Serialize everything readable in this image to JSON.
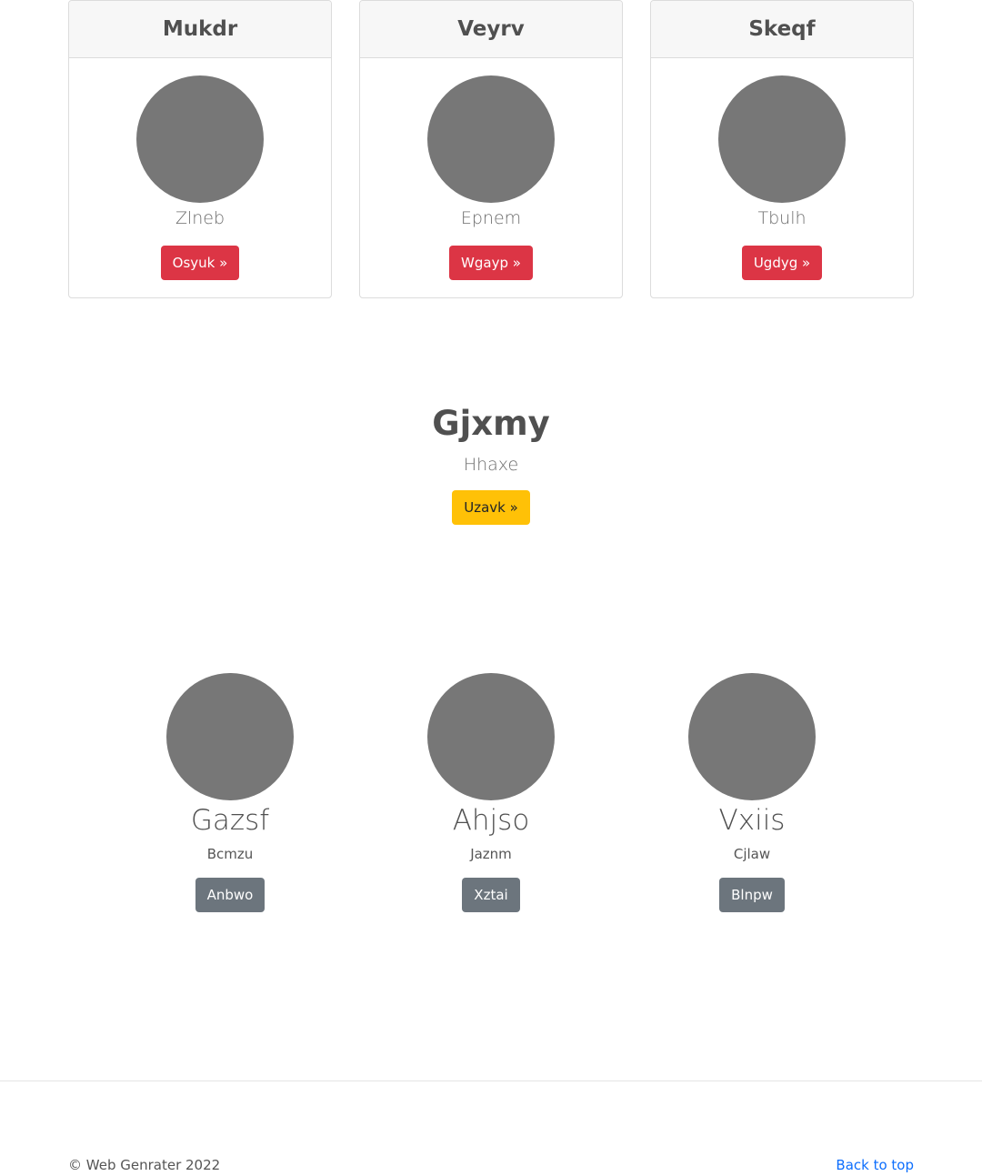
{
  "cards": [
    {
      "title": "Mukdr",
      "subtitle": "Zlneb",
      "button": "Osyuk »"
    },
    {
      "title": "Veyrv",
      "subtitle": "Epnem",
      "button": "Wgayp »"
    },
    {
      "title": "Skeqf",
      "subtitle": "Tbulh",
      "button": "Ugdyg »"
    }
  ],
  "hero": {
    "title": "Gjxmy",
    "subtitle": "Hhaxe",
    "button": "Uzavk »"
  },
  "people": [
    {
      "name": "Gazsf",
      "subtitle": "Bcmzu",
      "button": "Anbwo"
    },
    {
      "name": "Ahjso",
      "subtitle": "Jaznm",
      "button": "Xztai"
    },
    {
      "name": "Vxiis",
      "subtitle": "Cjlaw",
      "button": "Blnpw"
    }
  ],
  "footer": {
    "copyright": "© Web Genrater 2022",
    "back_to_top": "Back to top"
  },
  "colors": {
    "danger": "#dc3545",
    "warning": "#ffc107",
    "secondary": "#6c757d",
    "link": "#0d6efd",
    "avatar": "#777777"
  }
}
